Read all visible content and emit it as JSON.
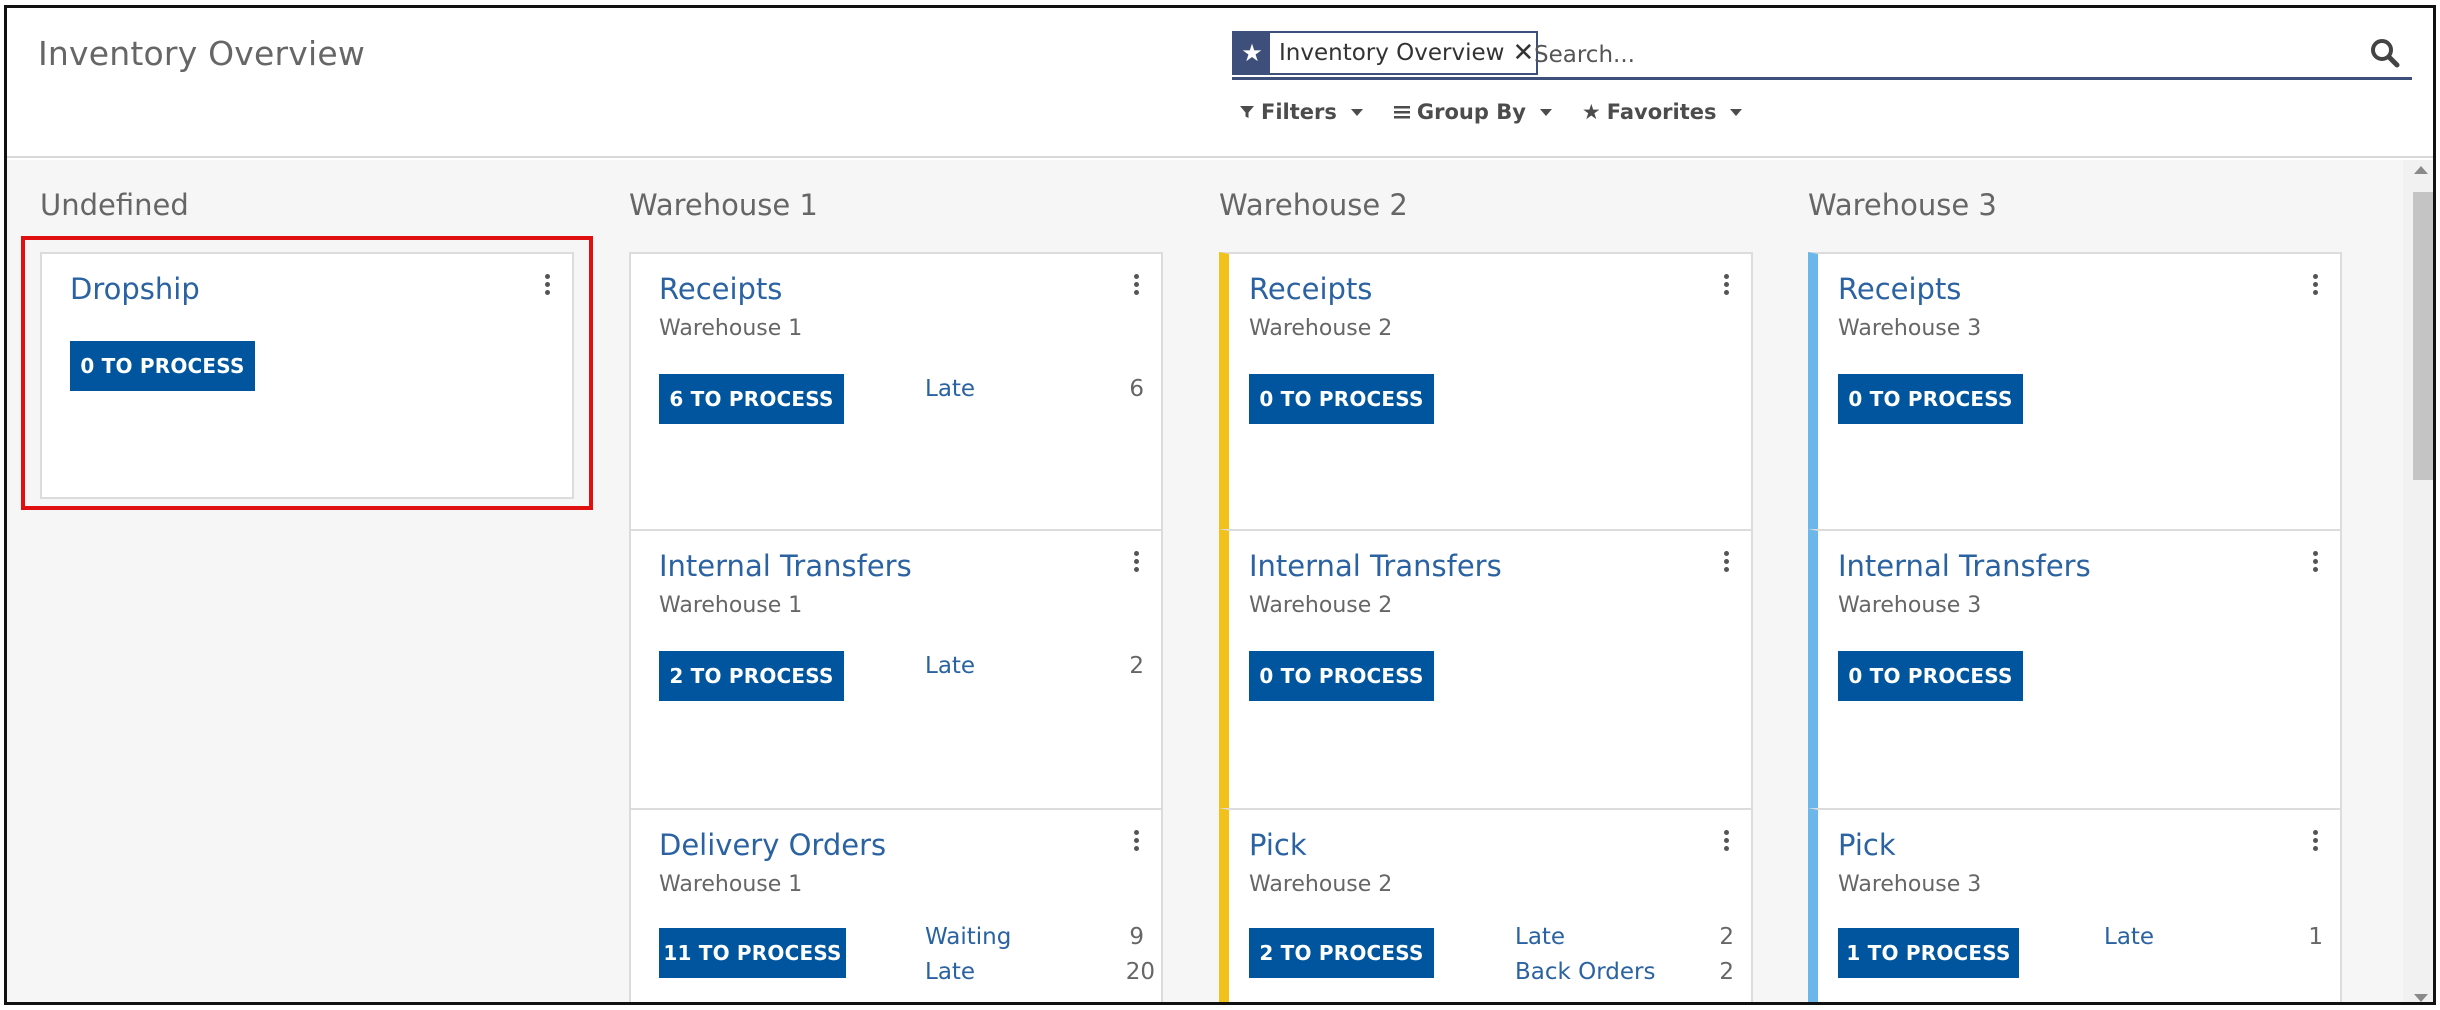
{
  "header": {
    "title": "Inventory Overview"
  },
  "search": {
    "facet_label": "Inventory Overview",
    "placeholder": "Search...",
    "options": {
      "filters": "Filters",
      "group_by": "Group By",
      "favorites": "Favorites"
    }
  },
  "columns": [
    {
      "title": "Undefined",
      "cards": [
        {
          "name": "Dropship",
          "button": "0 TO PROCESS"
        }
      ]
    },
    {
      "title": "Warehouse 1",
      "cards": [
        {
          "name": "Receipts",
          "subtitle": "Warehouse 1",
          "button": "6 TO PROCESS",
          "stats": [
            {
              "label": "Late",
              "value": "6"
            }
          ]
        },
        {
          "name": "Internal Transfers",
          "subtitle": "Warehouse 1",
          "button": "2 TO PROCESS",
          "stats": [
            {
              "label": "Late",
              "value": "2"
            }
          ]
        },
        {
          "name": "Delivery Orders",
          "subtitle": "Warehouse 1",
          "button": "11 TO PROCESS",
          "stats": [
            {
              "label": "Waiting",
              "value": "9"
            },
            {
              "label": "Late",
              "value": "20"
            }
          ]
        }
      ]
    },
    {
      "title": "Warehouse 2",
      "color": "#f2c21b",
      "cards": [
        {
          "name": "Receipts",
          "subtitle": "Warehouse 2",
          "button": "0 TO PROCESS"
        },
        {
          "name": "Internal Transfers",
          "subtitle": "Warehouse 2",
          "button": "0 TO PROCESS"
        },
        {
          "name": "Pick",
          "subtitle": "Warehouse 2",
          "button": "2 TO PROCESS",
          "stats": [
            {
              "label": "Late",
              "value": "2"
            },
            {
              "label": "Back Orders",
              "value": "2"
            }
          ]
        }
      ]
    },
    {
      "title": "Warehouse 3",
      "color": "#6cb7ea",
      "cards": [
        {
          "name": "Receipts",
          "subtitle": "Warehouse 3",
          "button": "0 TO PROCESS"
        },
        {
          "name": "Internal Transfers",
          "subtitle": "Warehouse 3",
          "button": "0 TO PROCESS"
        },
        {
          "name": "Pick",
          "subtitle": "Warehouse 3",
          "button": "1 TO PROCESS",
          "stats": [
            {
              "label": "Late",
              "value": "1"
            }
          ]
        }
      ]
    }
  ],
  "colors": {
    "primary": "#00569e",
    "link": "#2a62a2",
    "highlight": "#e01010"
  },
  "icons": {
    "facet": "star-icon",
    "remove": "close-icon",
    "search": "search-icon",
    "filters": "funnel-icon",
    "group_by": "list-icon",
    "favorites": "star-icon",
    "card_menu": "kebab-icon"
  }
}
